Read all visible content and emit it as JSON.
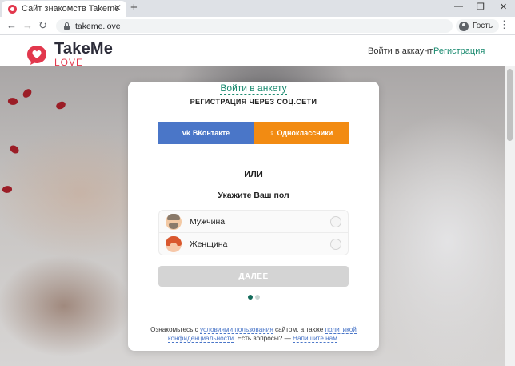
{
  "browser": {
    "tab_title": "Сайт знакомств Takeme",
    "tab_close": "✕",
    "new_tab": "+",
    "minimize": "—",
    "maximize": "❐",
    "close": "✕",
    "back": "←",
    "forward": "→",
    "reload": "↻",
    "url": "takeme.love",
    "profile_label": "Гость",
    "menu": "⋮"
  },
  "header": {
    "logo_title": "TakeMe",
    "logo_sub": "LOVE",
    "login_link": "Войти в аккаунт",
    "register_link": "Регистрация",
    "accent_color": "#1a8a6f",
    "brand_color": "#e2384d"
  },
  "card": {
    "top_link": "Войти в анкету",
    "social_title": "РЕГИСТРАЦИЯ ЧЕРЕЗ СОЦ.СЕТИ",
    "vk_icon": "vk",
    "vk_label": "ВКонтакте",
    "vk_color": "#4a76c8",
    "ok_icon": "♀",
    "ok_label": "Одноклассники",
    "ok_color": "#f28b12",
    "or_label": "ИЛИ",
    "gender_title": "Укажите Ваш пол",
    "gender_options": [
      {
        "label": "Мужчина",
        "avatar": "man-avatar-icon",
        "selected": false
      },
      {
        "label": "Женщина",
        "avatar": "woman-avatar-icon",
        "selected": false
      }
    ],
    "next_button": "ДАЛЕЕ",
    "step": {
      "current": 1,
      "total": 2
    },
    "footer": {
      "t1": "Ознакомьтесь с ",
      "link_terms": "условиями пользования",
      "t2": " сайтом, а также ",
      "link_privacy_a": "политикой",
      "link_privacy_b": "конфиденциальности",
      "t3": ". Есть вопросы? — ",
      "link_contact": "Напишите нам",
      "t4": "."
    }
  }
}
